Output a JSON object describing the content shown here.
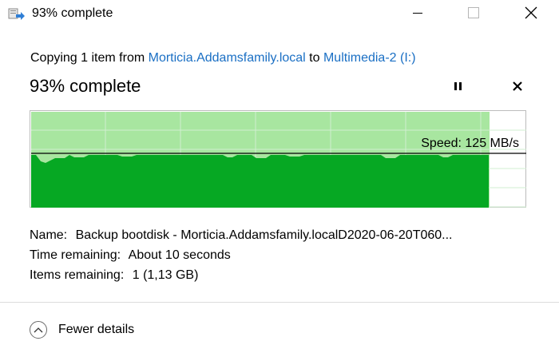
{
  "window": {
    "title": "93% complete",
    "icon": "file-copy-arrow-icon",
    "controls": [
      "minimize-icon",
      "maximize-icon",
      "close-icon"
    ]
  },
  "copy": {
    "prefix": "Copying 1 item from",
    "source": "Morticia.Addamsfamily.local",
    "to": "to",
    "destination": "Multimedia-2 (I:)"
  },
  "status": {
    "big_text": "93% complete",
    "progress_fraction": 0.93
  },
  "graph": {
    "speed_label": "Speed: 125 MB/s",
    "colors": {
      "fill": "#06a823",
      "background_fill": "#a8e6a0",
      "line": "#000000",
      "grid": "#d0efd0"
    }
  },
  "details": {
    "name_label": "Name:",
    "name_value": "Backup bootdisk - Morticia.Addamsfamily.localD2020-06-20T060...",
    "time_label": "Time remaining:",
    "time_value": "About 10 seconds",
    "items_label": "Items remaining:",
    "items_value": "1 (1,13 GB)"
  },
  "footer": {
    "fewer_details": "Fewer details",
    "icon": "chevron-up-icon"
  }
}
